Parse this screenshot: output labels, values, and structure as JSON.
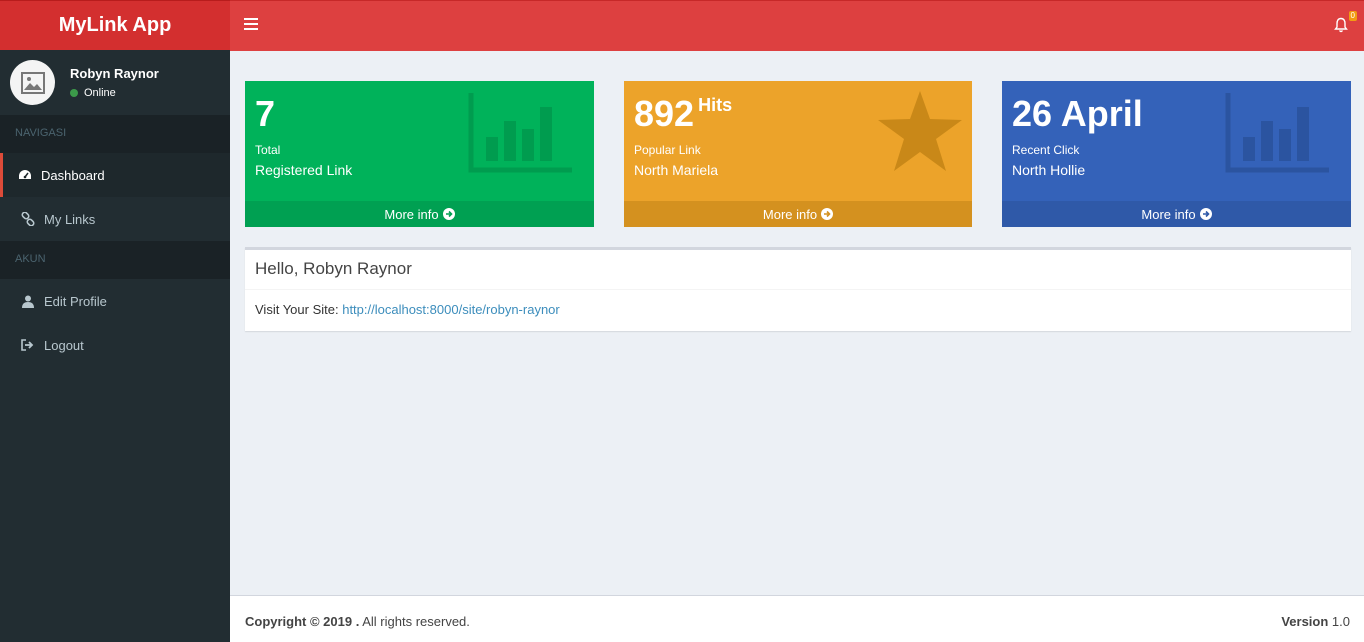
{
  "app": {
    "title": "MyLink App"
  },
  "user": {
    "name": "Robyn Raynor",
    "status": "Online"
  },
  "sidebar": {
    "sections": [
      {
        "header": "NAVIGASI",
        "items": [
          {
            "label": "Dashboard",
            "icon": "dashboard-icon",
            "active": true
          },
          {
            "label": "My Links",
            "icon": "link-icon",
            "active": false
          }
        ]
      },
      {
        "header": "AKUN",
        "items": [
          {
            "label": "Edit Profile",
            "icon": "user-icon",
            "active": false
          },
          {
            "label": "Logout",
            "icon": "sign-out-icon",
            "active": false
          }
        ]
      }
    ]
  },
  "header": {
    "notification_count": "0"
  },
  "boxes": [
    {
      "value": "7",
      "suffix": "",
      "line1": "Total",
      "line2": "Registered Link",
      "more": "More info",
      "color": "#00b25a",
      "icon": "bar-chart-icon"
    },
    {
      "value": "892",
      "suffix": "Hits",
      "line1": "Popular Link",
      "line2": "North Mariela",
      "more": "More info",
      "color": "#eca32a",
      "icon": "star-icon"
    },
    {
      "value": "26 April",
      "suffix": "",
      "line1": "Recent Click",
      "line2": "North Hollie",
      "more": "More info",
      "color": "#3462b9",
      "icon": "bar-chart-icon"
    }
  ],
  "panel": {
    "title": "Hello, Robyn Raynor",
    "site_label": "Visit Your Site:",
    "site_url": "http://localhost:8000/site/robyn-raynor"
  },
  "footer": {
    "copyright_bold": "Copyright © 2019 .",
    "copyright_rest": "All rights reserved.",
    "version_label": "Version",
    "version_value": "1.0"
  }
}
